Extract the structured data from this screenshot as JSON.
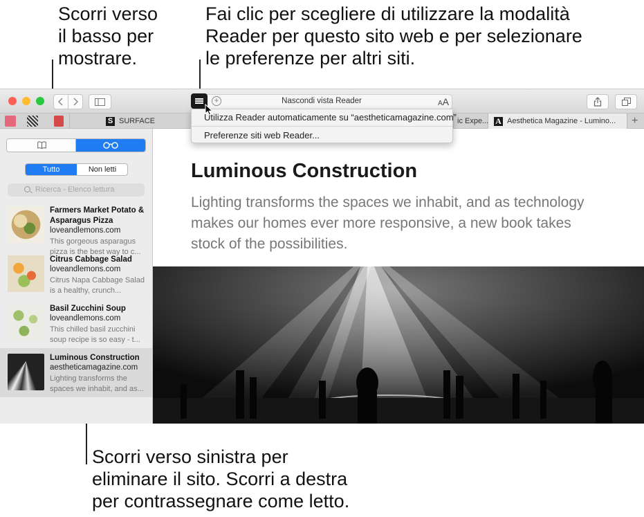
{
  "callouts": {
    "scroll_down": "Scorri verso\nil basso per\nmostrare.",
    "reader_click": "Fai clic per scegliere di utilizzare la modalità\nReader per questo sito web e per selezionare\nle preferenze per altri siti.",
    "swipe": "Scorri verso sinistra per\neliminare il sito. Scorri a destra\nper contrassegnare come letto."
  },
  "toolbar": {
    "address_title": "Nascondi vista Reader",
    "text_size_small": "A",
    "text_size_large": "A"
  },
  "tabs": {
    "surface_logo": "S",
    "surface_label": "SURFACE",
    "partial_label": "ic Expe...",
    "aesthetica_logo": "A",
    "aesthetica_label": "Aesthetica Magazine - Lumino...",
    "new_tab": "+"
  },
  "reader_menu": {
    "auto_reader": "Utilizza Reader automaticamente su “aestheticamagazine.com”",
    "preferences": "Preferenze siti web Reader..."
  },
  "sidebar": {
    "filter_all": "Tutto",
    "filter_unread": "Non letti",
    "search_placeholder": "Ricerca - Elenco lettura",
    "items": [
      {
        "title": "Farmers Market Potato & Asparagus Pizza",
        "domain": "loveandlemons.com",
        "excerpt": "This gorgeous asparagus pizza is the best way to c..."
      },
      {
        "title": "Citrus Cabbage Salad",
        "domain": "loveandlemons.com",
        "excerpt": "Citrus Napa Cabbage Salad is a healthy, crunch..."
      },
      {
        "title": "Basil Zucchini Soup",
        "domain": "loveandlemons.com",
        "excerpt": "This chilled basil zucchini soup recipe is so easy - t..."
      },
      {
        "title": "Luminous Construction",
        "domain": "aestheticamagazine.com",
        "excerpt": "Lighting transforms the spaces we inhabit, and as..."
      }
    ]
  },
  "article": {
    "title": "Luminous Construction",
    "subtitle": "Lighting transforms the spaces we inhabit, and as technology makes our homes ever more responsive, a new book takes stock of the possibilities."
  },
  "colors": {
    "accent_blue": "#1f7cf2",
    "close": "#fd5f57",
    "minimize": "#febc2e",
    "zoom": "#28c840"
  }
}
